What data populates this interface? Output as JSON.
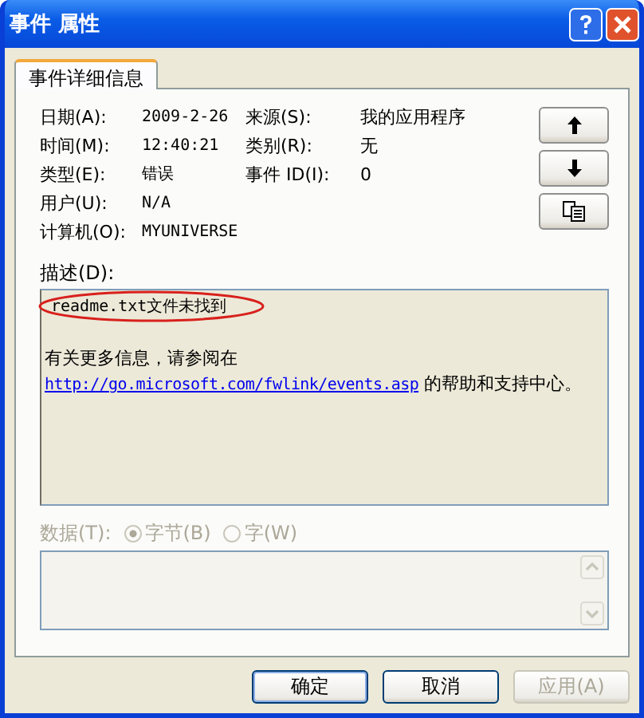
{
  "window": {
    "title": "事件 属性"
  },
  "tabs": [
    {
      "label": "事件详细信息",
      "selected": true
    }
  ],
  "fields": [
    {
      "label": "日期(A):",
      "value": "2009-2-26"
    },
    {
      "label": "来源(S):",
      "value": "我的应用程序"
    },
    {
      "label": "时间(M):",
      "value": "12:40:21"
    },
    {
      "label": "类别(R):",
      "value": "无"
    },
    {
      "label": "类型(E):",
      "value": "错误"
    },
    {
      "label": "事件 ID(I):",
      "value": "0"
    },
    {
      "label": "用户(U):",
      "value": "N/A"
    },
    {
      "label": "计算机(O):",
      "value": "MYUNIVERSE"
    }
  ],
  "description": {
    "label": "描述(D):",
    "first_line": "readme.txt文件未找到",
    "first_line_circled": true,
    "text": "有关更多信息，请参阅在",
    "link": "http://go.microsoft.com/fwlink/events.asp",
    "after_link": "的帮助和支持中心。"
  },
  "data": {
    "label": "数据(T):",
    "disabled": true,
    "options": [
      {
        "label": "字节(B)",
        "selected": true
      },
      {
        "label": "字(W)",
        "selected": false
      }
    ]
  },
  "buttons": [
    {
      "label": "确定",
      "disabled": false
    },
    {
      "label": "取消",
      "disabled": false
    },
    {
      "label": "应用(A)",
      "disabled": true
    }
  ]
}
